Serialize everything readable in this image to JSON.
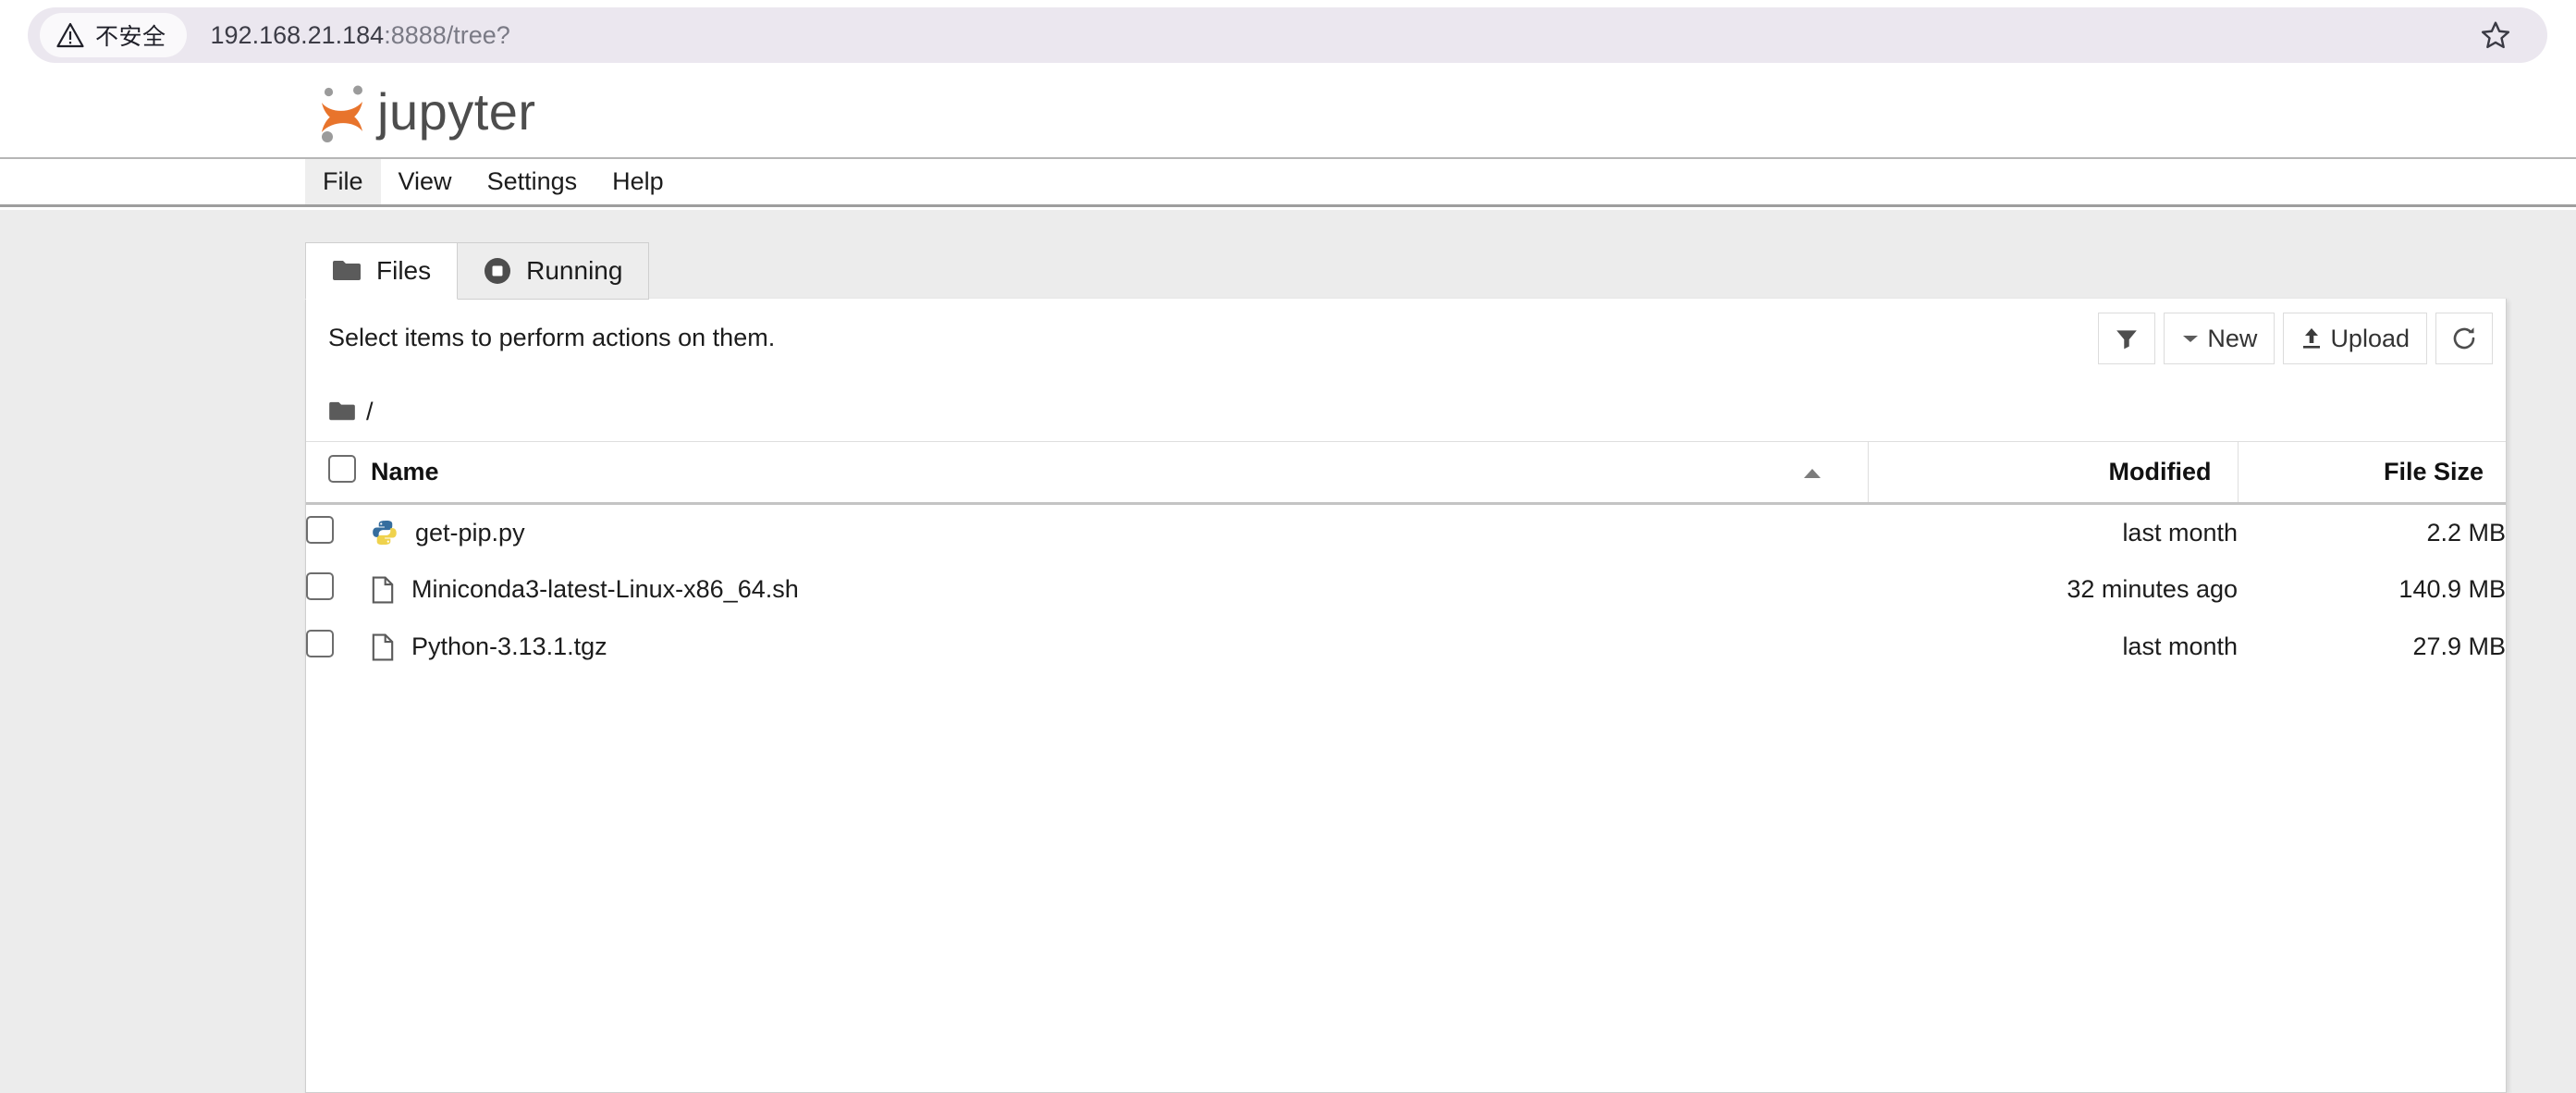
{
  "browser": {
    "security_badge": "不安全",
    "security_icon": "warning-triangle-icon",
    "url_host": "192.168.21.184",
    "url_rest": ":8888/tree?",
    "bookmark_icon": "star-outline-icon"
  },
  "header": {
    "logo_icon": "jupyter-logo-icon",
    "wordmark": "jupyter",
    "logo_color": "#e8742c"
  },
  "menu": {
    "items": [
      {
        "label": "File",
        "active": true
      },
      {
        "label": "View",
        "active": false
      },
      {
        "label": "Settings",
        "active": false
      },
      {
        "label": "Help",
        "active": false
      }
    ]
  },
  "tabs": [
    {
      "label": "Files",
      "icon": "folder-icon",
      "active": true
    },
    {
      "label": "Running",
      "icon": "stop-circle-icon",
      "active": false
    }
  ],
  "toolbar": {
    "select_hint": "Select items to perform actions on them.",
    "filter_label": "",
    "filter_icon": "filter-funnel-icon",
    "new_label": "New",
    "new_caret_icon": "caret-down-icon",
    "upload_label": "Upload",
    "upload_icon": "upload-icon",
    "refresh_label": "",
    "refresh_icon": "refresh-icon"
  },
  "breadcrumb": {
    "folder_icon": "folder-icon",
    "root_label": "/"
  },
  "table": {
    "headers": {
      "name": "Name",
      "modified": "Modified",
      "size": "File Size"
    },
    "sort_indicator_icon": "sort-ascending-icon",
    "select_all_checkbox": "unchecked",
    "rows": [
      {
        "checkbox": "unchecked",
        "icon": "python-file-icon",
        "name": "get-pip.py",
        "modified": "last month",
        "size": "2.2 MB"
      },
      {
        "checkbox": "unchecked",
        "icon": "generic-file-icon",
        "name": "Miniconda3-latest-Linux-x86_64.sh",
        "modified": "32 minutes ago",
        "size": "140.9 MB"
      },
      {
        "checkbox": "unchecked",
        "icon": "generic-file-icon",
        "name": "Python-3.13.1.tgz",
        "modified": "last month",
        "size": "27.9 MB"
      }
    ]
  }
}
